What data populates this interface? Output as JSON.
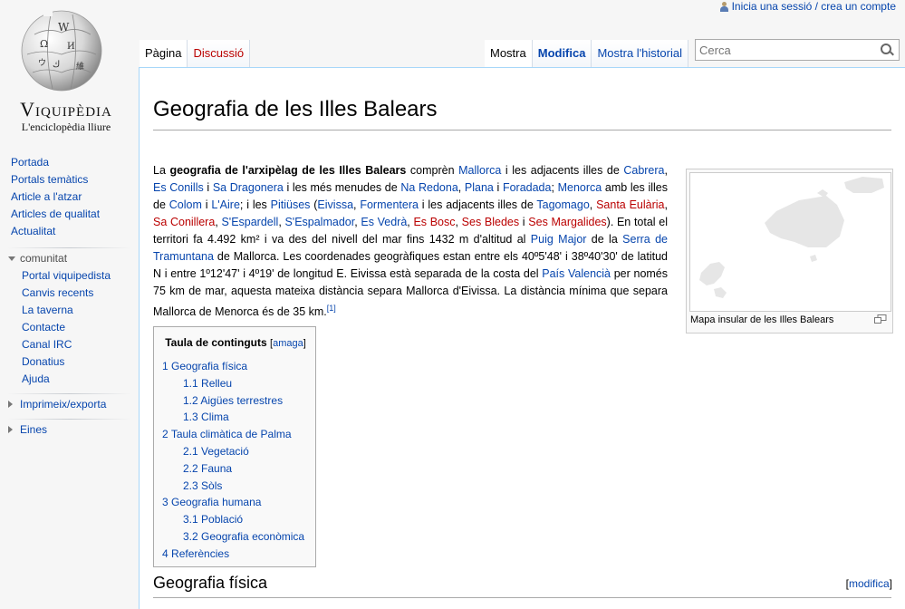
{
  "personal": {
    "login": "Inicia una sessió / crea un compte"
  },
  "logo": {
    "title": "Viquipèdia",
    "subtitle": "L'enciclopèdia lliure"
  },
  "sidebar": {
    "main": [
      "Portada",
      "Portals temàtics",
      "Article a l'atzar",
      "Articles de qualitat",
      "Actualitat"
    ],
    "community_heading": "comunitat",
    "community": [
      "Portal viquipedista",
      "Canvis recents",
      "La taverna",
      "Contacte",
      "Canal IRC",
      "Donatius",
      "Ajuda"
    ],
    "print_heading": "Imprimeix/exporta",
    "tools_heading": "Eines"
  },
  "tabs": {
    "page": "Pàgina",
    "talk": "Discussió",
    "read": "Mostra",
    "edit": "Modifica",
    "history": "Mostra l'historial"
  },
  "search": {
    "placeholder": "Cerca"
  },
  "article": {
    "title": "Geografia de les Illes Balears",
    "intro": {
      "t1": "La ",
      "bold": "geografia de l'arxipèlag de les Illes Balears",
      "t2": " comprèn ",
      "l_mallorca": "Mallorca",
      "t3": " i les adjacents illes de ",
      "l_cabrera": "Cabrera",
      "t4": ", ",
      "l_conills": "Es Conills",
      "t5": " i ",
      "l_dragonera": "Sa Dragonera",
      "t6": " i les més menudes de ",
      "l_naredona": "Na Redona",
      "t7": ", ",
      "l_plana": "Plana",
      "t8": " i ",
      "l_foradada": "Foradada",
      "t9": "; ",
      "l_menorca": "Menorca",
      "t10": " amb les illes de ",
      "l_colom": "Colom",
      "t11": " i ",
      "l_laire": "L'Aire",
      "t12": "; i les ",
      "l_pitiuses": "Pitiüses",
      "t13": " (",
      "l_eivissa": "Eivissa",
      "t14": ", ",
      "l_formentera": "Formentera",
      "t15": " i les adjacents illes de ",
      "l_tagomago": "Tagomago",
      "t16": ", ",
      "l_santaeularia": "Santa Eulària",
      "t17": ", ",
      "l_conillera": "Sa Conillera",
      "t18": ", ",
      "l_espardell": "S'Espardell",
      "t19": ", ",
      "l_espalmador": "S'Espalmador",
      "t20": ", ",
      "l_vedra": "Es Vedrà",
      "t21": ", ",
      "l_bosc": "Es Bosc",
      "t22": ", ",
      "l_bledes": "Ses Bledes",
      "t23": " i ",
      "l_margalides": "Ses Margalides",
      "t24": "). En total el territori fa 4.492 km² i va des del nivell del mar fins 1432 m d'altitud al ",
      "l_puigmajor": "Puig Major",
      "t25": " de la ",
      "l_tramuntana": "Serra de Tramuntana",
      "t26": " de Mallorca. Les coordenades geogràfiques estan entre els 40º5'48' i 38º40'30' de latitud N i entre 1º12'47' i 4º19' de longitud E. Eivissa està separada de la costa del ",
      "l_valencia": "País Valencià",
      "t27": " per només 75 km de mar, aquesta mateixa distància separa Mallorca d'Eivissa. La distància mínima que separa Mallorca de Menorca és de 35 km.",
      "ref": "[1]"
    },
    "thumb_caption": "Mapa insular de les Illes Balears",
    "toc": {
      "title": "Taula de continguts",
      "hide_open": "[",
      "hide": "amaga",
      "hide_close": "]",
      "items": [
        {
          "num": "1",
          "text": "Geografia física"
        },
        {
          "num": "1.1",
          "text": "Relleu"
        },
        {
          "num": "1.2",
          "text": "Aigües terrestres"
        },
        {
          "num": "1.3",
          "text": "Clima"
        },
        {
          "num": "2",
          "text": "Taula climàtica de Palma"
        },
        {
          "num": "2.1",
          "text": "Vegetació"
        },
        {
          "num": "2.2",
          "text": "Fauna"
        },
        {
          "num": "2.3",
          "text": "Sòls"
        },
        {
          "num": "3",
          "text": "Geografia humana"
        },
        {
          "num": "3.1",
          "text": "Població"
        },
        {
          "num": "3.2",
          "text": "Geografia econòmica"
        },
        {
          "num": "4",
          "text": "Referències"
        }
      ]
    },
    "section_heading": "Geografia física",
    "section_edit": {
      "open": "[",
      "label": "modifica",
      "close": "]"
    }
  }
}
